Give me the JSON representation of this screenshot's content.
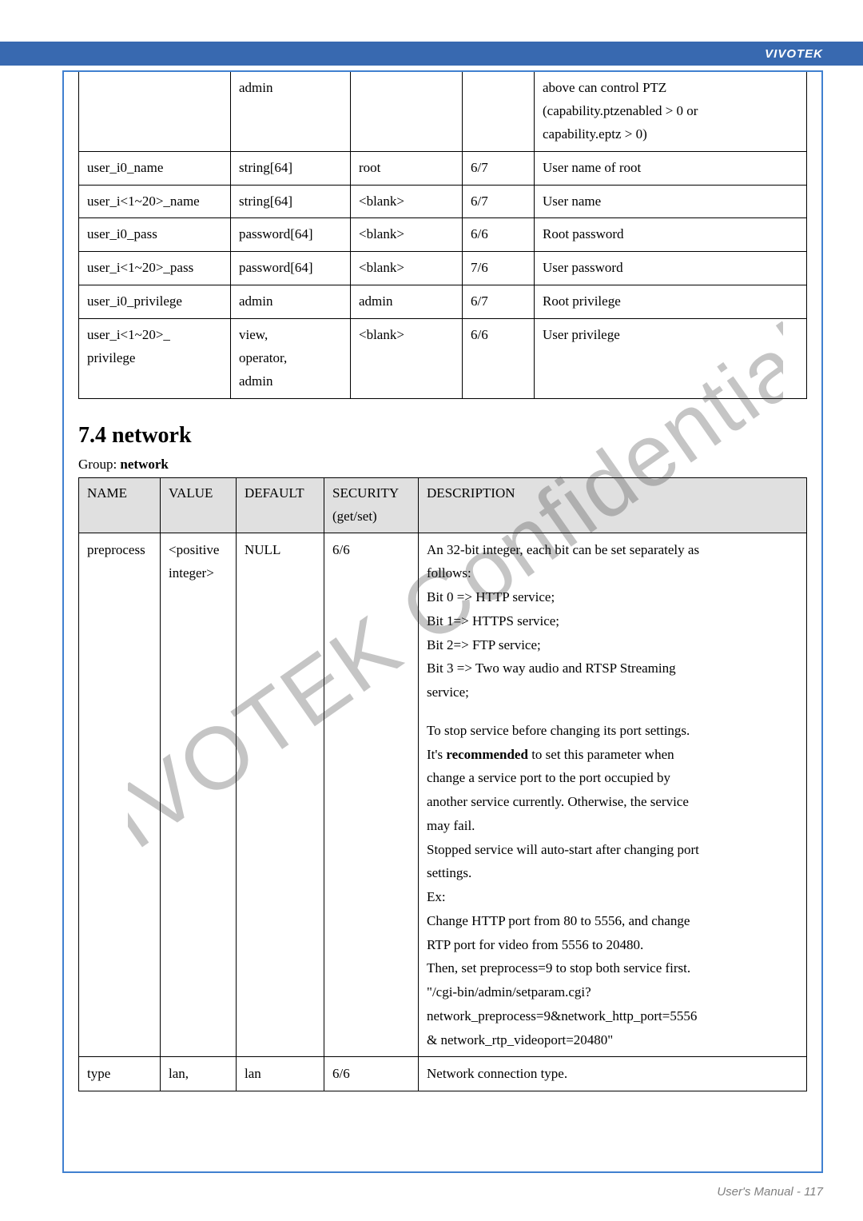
{
  "header": {
    "brand": "VIVOTEK"
  },
  "table1": {
    "rows": [
      {
        "c1": "",
        "c2": "admin",
        "c3": "",
        "c4": "",
        "c5a": "above can control PTZ",
        "c5b": "(capability.ptzenabled > 0 or",
        "c5c": "capability.eptz > 0)"
      },
      {
        "c1": "user_i0_name",
        "c2": "string[64]",
        "c3": "root",
        "c4": "6/7",
        "c5a": "User name of root"
      },
      {
        "c1": "user_i<1~20>_name",
        "c2": "string[64]",
        "c3": "<blank>",
        "c4": "6/7",
        "c5a": "User name"
      },
      {
        "c1": "user_i0_pass",
        "c2": "password[64]",
        "c3": "<blank>",
        "c4": "6/6",
        "c5a": "Root password"
      },
      {
        "c1": "user_i<1~20>_pass",
        "c2": "password[64]",
        "c3": "<blank>",
        "c4": "7/6",
        "c5a": "User password"
      },
      {
        "c1": "user_i0_privilege",
        "c2": "admin",
        "c3": "admin",
        "c4": "6/7",
        "c5a": "Root privilege"
      },
      {
        "c1a": "user_i<1~20>_",
        "c1b": "privilege",
        "c2a": "view,",
        "c2b": "operator,",
        "c2c": "admin",
        "c3": "<blank>",
        "c4": "6/6",
        "c5a": "User privilege"
      }
    ]
  },
  "section": {
    "heading": "7.4 network",
    "group_prefix": "Group: ",
    "group_name": "network"
  },
  "table2": {
    "headers": {
      "name": "NAME",
      "value": "VALUE",
      "default": "DEFAULT",
      "security": "SECURITY",
      "security_sub": "(get/set)",
      "description": "DESCRIPTION"
    },
    "rows": [
      {
        "name": "preprocess",
        "value_a": "<positive",
        "value_b": "integer>",
        "default": "NULL",
        "security": "6/6",
        "desc": {
          "l1": "An 32-bit integer, each bit can be set separately as",
          "l2": "follows:",
          "l3": "Bit 0 => HTTP service;",
          "l4": "Bit 1=> HTTPS service;",
          "l5": "Bit 2=> FTP service;",
          "l6": "Bit 3 => Two way audio and RTSP Streaming",
          "l7": "service;",
          "l9": "To stop service before changing its port settings.",
          "l10a": "It's ",
          "l10b": "recommended",
          "l10c": " to set this parameter when",
          "l11": "change a service port to the port occupied by",
          "l12": "another service currently. Otherwise, the service",
          "l13": "may fail.",
          "l14": "Stopped service will auto-start after changing port",
          "l15": "settings.",
          "l16": "Ex:",
          "l17": "Change HTTP port from 80 to 5556, and change",
          "l18": "RTP port for video from 5556 to 20480.",
          "l19": "Then, set preprocess=9 to stop both service first.",
          "l20": "\"/cgi-bin/admin/setparam.cgi?",
          "l21": "network_preprocess=9&network_http_port=5556",
          "l22": "& network_rtp_videoport=20480\""
        }
      },
      {
        "name": "type",
        "value_a": "lan,",
        "default": "lan",
        "security": "6/6",
        "desc": {
          "l1": "Network connection type."
        }
      }
    ]
  },
  "footer": {
    "text": "User's Manual - 117"
  }
}
